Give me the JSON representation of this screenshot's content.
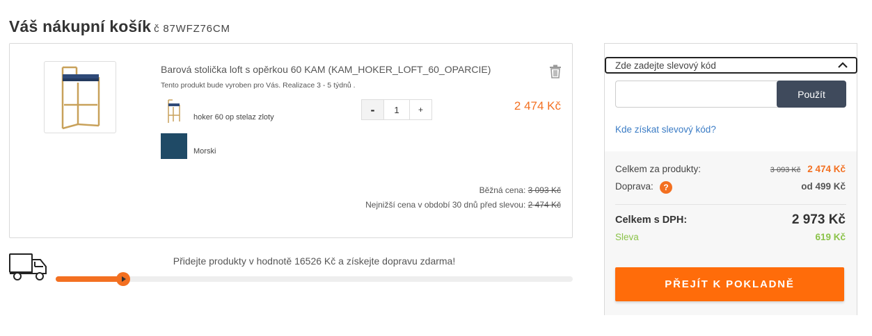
{
  "header": {
    "title": "Váš nákupní košík",
    "order_code": "č 87WFZ76CM"
  },
  "cart": {
    "items": [
      {
        "name": "Barová stolička loft s opěrkou 60 KAM (KAM_HOKER_LOFT_60_OPARCIE)",
        "note": "Tento produkt bude vyroben pro Vás. Realizace 3 - 5 týdnů .",
        "options": [
          {
            "label": "hoker 60 op stelaz zloty",
            "icon": "stool-frame-swatch"
          },
          {
            "label": "Morski",
            "icon": "fabric-swatch",
            "color": "#1f4a66"
          }
        ],
        "quantity": "1",
        "qty_minus": "-",
        "qty_plus": "+",
        "price": "2 474 Kč",
        "regular_price_label": "Běžná cena:",
        "regular_price_value": "3 093 Kč",
        "lowest_price_label": "Nejnižší cena v období 30 dnů před slevou:",
        "lowest_price_value": "2 474 Kč"
      }
    ]
  },
  "shipping_progress": {
    "message": "Přidejte produkty v hodnotě 16526 Kč a získejte dopravu zdarma!",
    "fraction": 0.13
  },
  "summary": {
    "coupon_toggle_label": "Zde zadejte slevový kód",
    "coupon_placeholder": "",
    "apply_label": "Použít",
    "coupon_link": "Kde získat slevový kód?",
    "products_label": "Celkem za produkty:",
    "products_old": "3 093 Kč",
    "products_new": "2 474 Kč",
    "shipping_label": "Doprava:",
    "shipping_help": "?",
    "shipping_value": "od 499 Kč",
    "total_label": "Celkem s DPH:",
    "total_value": "2 973 Kč",
    "discount_label": "Sleva",
    "discount_value": "619 Kč",
    "checkout_label": "PŘEJÍT K POKLADNĚ"
  },
  "colors": {
    "accent": "#f37021",
    "button_dark": "#3f4a5c",
    "link": "#3b7cc5",
    "discount": "#8bc34a"
  }
}
